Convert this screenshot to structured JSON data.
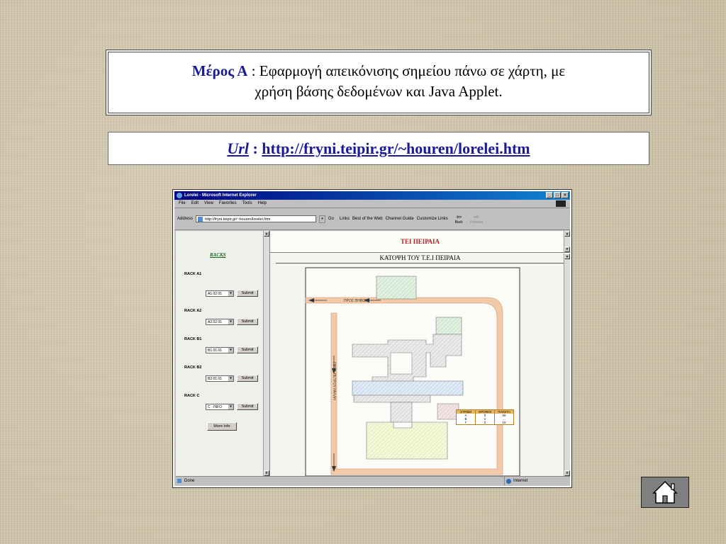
{
  "slide": {
    "title_strong": "Μέρος Α",
    "title_rest": " : Εφαρμογή απεικόνισης σημείου πάνω σε χάρτη, με",
    "title_line2": "χρήση βάσης δεδομένων και Java Applet.",
    "url_label": "Url",
    "url_sep": " : ",
    "url_link": "http://fryni.teipir.gr/~houren/lorelei.htm"
  },
  "browser": {
    "window_title": "Lorelei - Microsoft Internet Explorer",
    "menu": [
      "File",
      "Edit",
      "View",
      "Favorites",
      "Tools",
      "Help"
    ],
    "address_label": "Address",
    "address_value": "http://fryni.teipir.gr/~houren/lorelei.htm",
    "go_label": "Go",
    "links_label": "Links",
    "links": [
      "Best of the Web",
      "Channel Guide",
      "Customize Links"
    ],
    "back_label": "Back",
    "forward_label": "Forward",
    "status_left": "Done",
    "status_right": "Internet"
  },
  "left_frame": {
    "title": "RACKS",
    "racks": [
      {
        "label": "RACK A1",
        "value": "A1.02.01",
        "submit": "Submit"
      },
      {
        "label": "RACK A2",
        "value": "A2.02.01",
        "submit": "Submit"
      },
      {
        "label": "RACK B1",
        "value": "B1.01.01",
        "submit": "Submit"
      },
      {
        "label": "RACK B2",
        "value": "B2.01.01",
        "submit": "Submit"
      },
      {
        "label": "RACK C",
        "value": "C - INFO",
        "submit": "Submit"
      }
    ],
    "more_info": "More Info"
  },
  "right_frame": {
    "header": "ΤΕΙ ΠΕΙΡΑΙΑ",
    "plan_title": "ΚΑΤΟΨΗ ΤΟΥ Τ.Ε.Ι ΠΕΙΡΑΙΑ",
    "road_top": "ΠΡΟΣ ΘΗΒΩΝ",
    "road_left": "ΠΡΟΣ ΠΕΤΡΟΥ ΡΑΛΛΗ",
    "legend": {
      "headers": [
        "ΣΤΡΩΜ",
        "ΟΡΟΦΟΙ",
        "ΠΑΚΕΤΑ"
      ],
      "col1": [
        "A",
        "B",
        "Γ"
      ],
      "col2": [
        "0",
        "1",
        "2"
      ],
      "col3": [
        "00",
        "...",
        "10"
      ]
    }
  },
  "colors": {
    "title_blue": "#1a1a9a",
    "tei_red": "#b02020",
    "racks_green": "#1a6a1a",
    "road": "#f3c9a8"
  },
  "icons": [
    "ie-icon",
    "home-icon",
    "back-arrow-icon",
    "forward-arrow-icon",
    "windows-logo-icon"
  ]
}
